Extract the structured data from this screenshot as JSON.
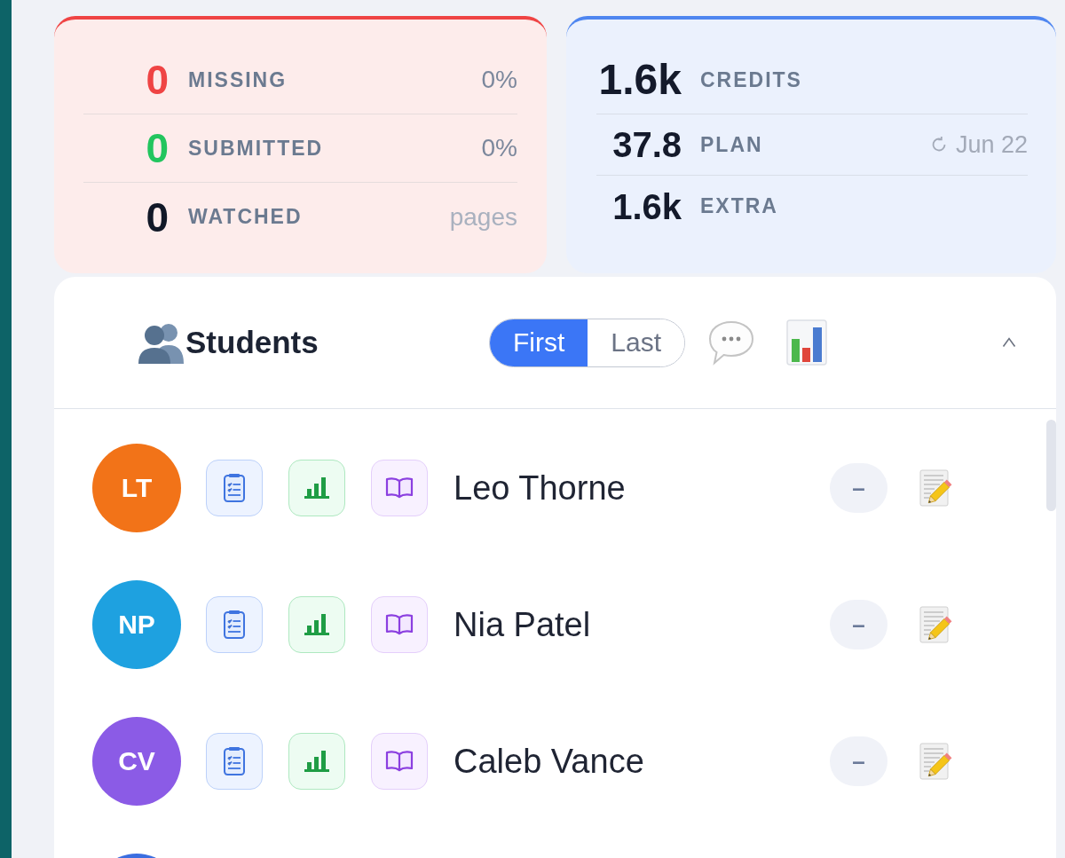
{
  "summary": {
    "rows": [
      {
        "value": "0",
        "label": "MISSING",
        "note": "0%",
        "color": "#ef4444"
      },
      {
        "value": "0",
        "label": "SUBMITTED",
        "note": "0%",
        "color": "#22c55e"
      },
      {
        "value": "0",
        "label": "WATCHED",
        "unit": "pages",
        "color": "#111827"
      }
    ]
  },
  "credits": {
    "rows": [
      {
        "kind": "total",
        "value": "1.6k",
        "label": "CREDITS"
      },
      {
        "kind": "part",
        "value": "37.8",
        "label": "PLAN",
        "renews": "Jun 22"
      },
      {
        "kind": "part",
        "value": "1.6k",
        "label": "EXTRA"
      }
    ]
  },
  "students": {
    "title": "Students",
    "sort": [
      {
        "label": "First",
        "selected": true
      },
      {
        "label": "Last",
        "selected": false
      }
    ],
    "expanded": true,
    "rows": [
      {
        "initials": "LT",
        "name": "Leo Thorne",
        "color": "#f27318",
        "score": "–"
      },
      {
        "initials": "NP",
        "name": "Nia Patel",
        "color": "#1ea1e0",
        "score": "–"
      },
      {
        "initials": "CV",
        "name": "Caleb Vance",
        "color": "#8b5be6",
        "score": "–"
      },
      {
        "color": "#3b6ee0"
      }
    ]
  }
}
